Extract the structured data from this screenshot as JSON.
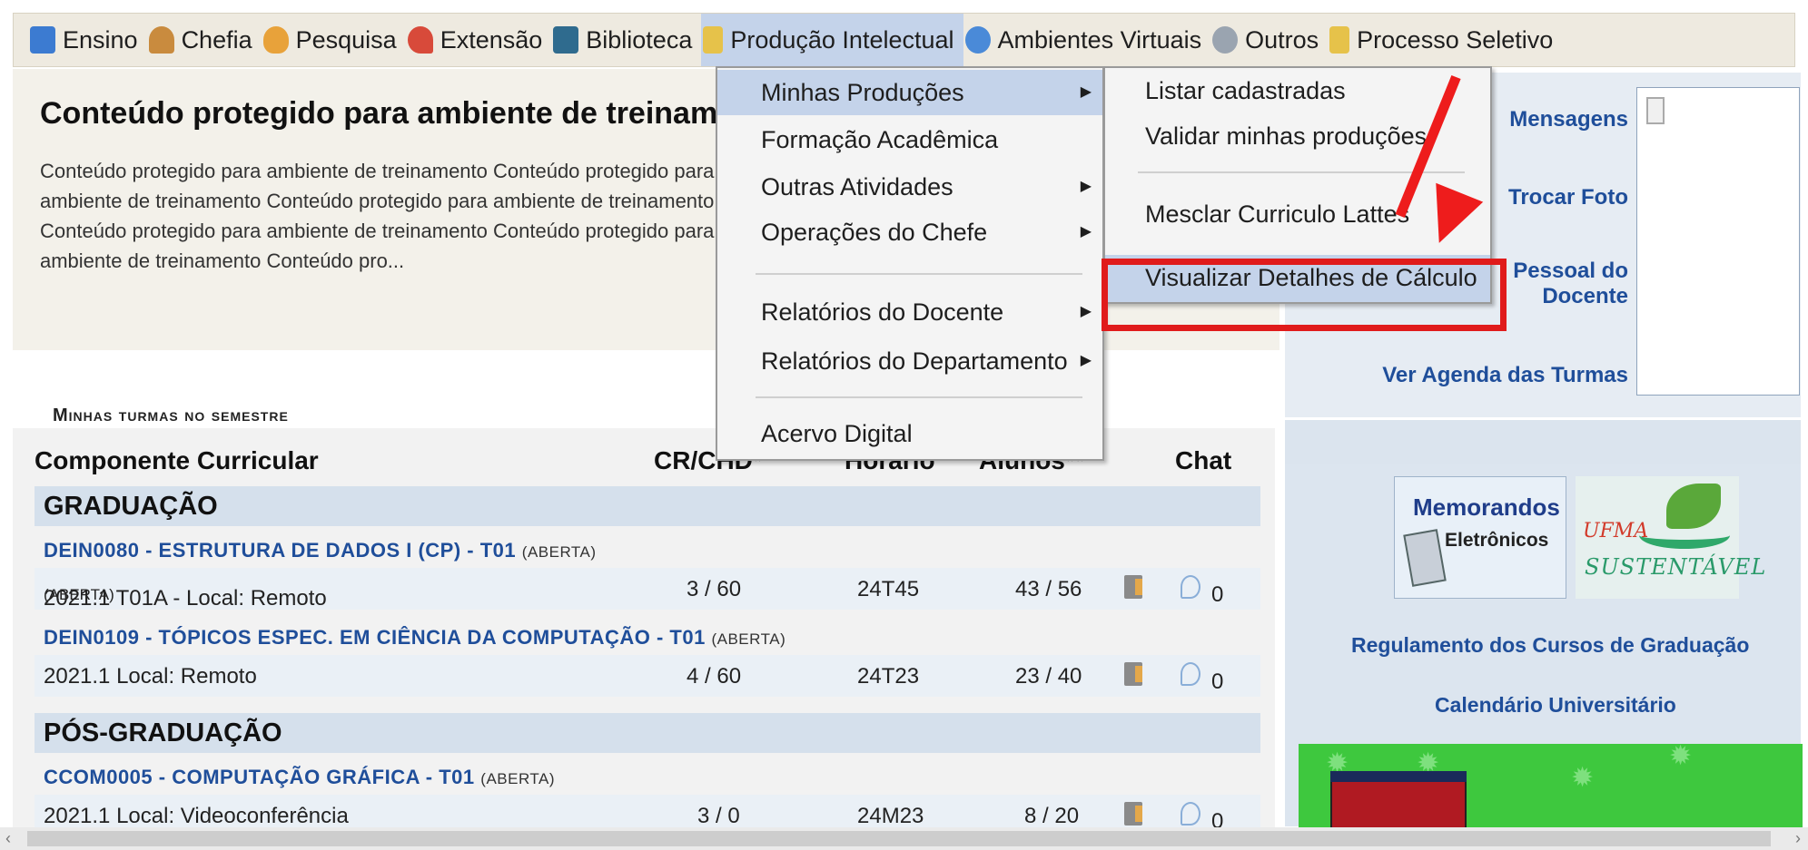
{
  "menubar": {
    "items": [
      {
        "label": "Ensino",
        "icon": "graduation-cap-icon",
        "color": "#3c7bd1"
      },
      {
        "label": "Chefia",
        "icon": "person-icon",
        "color": "#c98b3e"
      },
      {
        "label": "Pesquisa",
        "icon": "flask-icon",
        "color": "#e8a23a"
      },
      {
        "label": "Extensão",
        "icon": "heart-icon",
        "color": "#d84a3a"
      },
      {
        "label": "Biblioteca",
        "icon": "book-icon",
        "color": "#2f6b8e"
      },
      {
        "label": "Produção Intelectual",
        "icon": "document-icon",
        "color": "#e6c24a"
      },
      {
        "label": "Ambientes Virtuais",
        "icon": "network-icon",
        "color": "#4a8ad8"
      },
      {
        "label": "Outros",
        "icon": "globe-icon",
        "color": "#9aa4b0"
      },
      {
        "label": "Processo Seletivo",
        "icon": "document-icon",
        "color": "#e6c24a"
      }
    ],
    "active_index": 5
  },
  "intro": {
    "title": "Conteúdo protegido para ambiente de treinamento",
    "text": "Conteúdo protegido para ambiente de treinamento Conteúdo protegido para ambiente de treinamento Conteúdo protegido para ambiente de treinamento Conteúdo protegido para ambiente de treinamento Conteúdo protegido para ambiente de treinamento Conteúdo pro..."
  },
  "dropdown": {
    "items": [
      {
        "label": "Minhas Produções",
        "has_submenu": true,
        "active": true
      },
      {
        "label": "Formação Acadêmica",
        "has_submenu": false
      },
      {
        "label": "Outras Atividades",
        "has_submenu": true
      },
      {
        "label": "Operações do Chefe",
        "has_submenu": true
      },
      {
        "label": "Relatórios do Docente",
        "has_submenu": true
      },
      {
        "label": "Relatórios do Departamento",
        "has_submenu": true
      },
      {
        "label": "Acervo Digital",
        "has_submenu": false
      }
    ],
    "arrow": "▶"
  },
  "submenu": {
    "items": [
      {
        "label": "Listar cadastradas"
      },
      {
        "label": "Validar minhas produções"
      },
      {
        "label": "Mesclar Curriculo Lattes"
      },
      {
        "label": "Visualizar Detalhes de Cálculo",
        "active": true
      }
    ]
  },
  "turmas": {
    "caption": "Minhas turmas no semestre",
    "headers": {
      "component": "Componente Curricular",
      "crchd": "CR/CHD*",
      "horario": "Horário",
      "alunos": "Alunos**",
      "chat": "Chat"
    },
    "sections": [
      {
        "label": "GRADUAÇÃO",
        "courses": [
          {
            "code_title": "DEIN0080 - ESTRUTURA DE DADOS I (CP) - T01",
            "status": "(ABERTA)",
            "period": "2021.1 T01A - Local: Remoto",
            "period_status": "(ABERTA)",
            "crchd": "3 / 60",
            "horario": "24T45",
            "alunos": "43 / 56",
            "chat_count": "0"
          },
          {
            "code_title": "DEIN0109 - TÓPICOS ESPEC. EM CIÊNCIA DA COMPUTAÇÃO - T01",
            "status": "(ABERTA)",
            "period": "2021.1 Local: Remoto",
            "period_status": "",
            "crchd": "4 / 60",
            "horario": "24T23",
            "alunos": "23 / 40",
            "chat_count": "0"
          }
        ]
      },
      {
        "label": "PÓS-GRADUAÇÃO",
        "courses": [
          {
            "code_title": "CCOM0005 - COMPUTAÇÃO GRÁFICA - T01",
            "status": "(ABERTA)",
            "period": "2021.1 Local: Videoconferência",
            "period_status": "",
            "crchd": "3 / 0",
            "horario": "24M23",
            "alunos": "8 / 20",
            "chat_count": "0"
          }
        ]
      }
    ]
  },
  "right": {
    "links": {
      "mensagens": "Mensagens",
      "trocar_foto": "Trocar Foto",
      "pessoal_1": "Pessoal do",
      "pessoal_2": "Docente",
      "agenda": "Ver Agenda das Turmas"
    },
    "memo_1": "Memorandos",
    "memo_2": "Eletrônicos",
    "ufma_1": "UFMA",
    "ufma_2": "SUSTENTÁVEL",
    "regulamento": "Regulamento dos Cursos de Graduação",
    "calendario": "Calendário Universitário"
  },
  "colors": {
    "highlight": "#e01b1b",
    "link": "#1f4e9a",
    "menu_active": "#c4d3ea"
  }
}
